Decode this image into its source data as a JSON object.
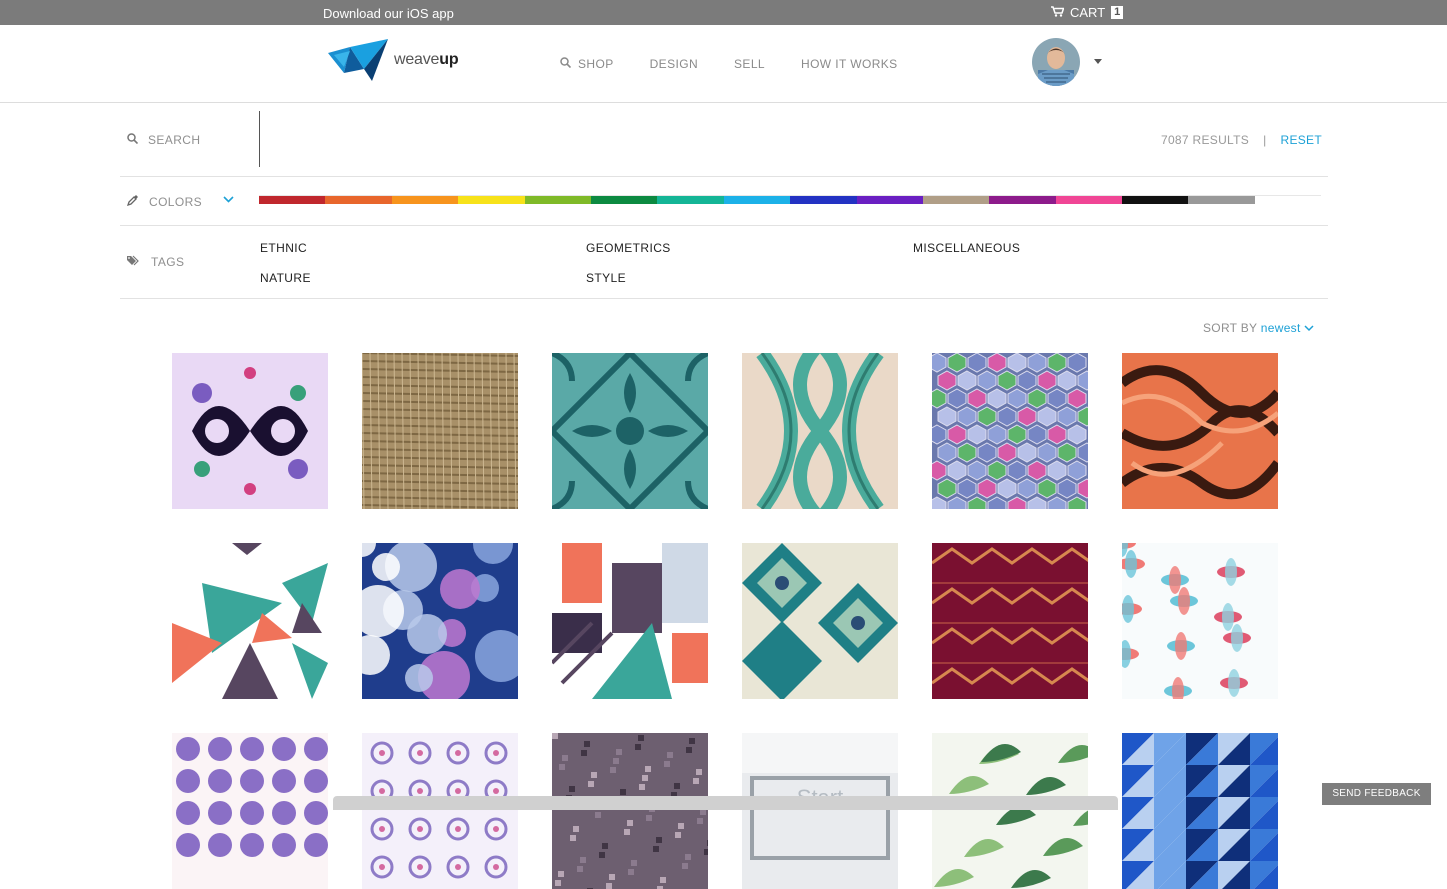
{
  "topbar": {
    "ios_label": "Download our iOS app",
    "cart_label": "CART",
    "cart_count": "1",
    "cart_icon": "cart-icon"
  },
  "brand": {
    "name_light": "weave",
    "name_bold": "up"
  },
  "nav": [
    {
      "label": "SHOP",
      "icon": "search-icon"
    },
    {
      "label": "DESIGN"
    },
    {
      "label": "SELL"
    },
    {
      "label": "HOW IT WORKS"
    }
  ],
  "filters": {
    "search_label": "SEARCH",
    "results": "7087 RESULTS",
    "separator": "|",
    "reset": "RESET",
    "colors_label": "COLORS",
    "tags_label": "TAGS",
    "color_swatches": [
      "#c0272d",
      "#e8662c",
      "#f7941d",
      "#f7e21a",
      "#7fba28",
      "#0c8a41",
      "#14b596",
      "#1cb1e8",
      "#2332c3",
      "#6a1fc2",
      "#b09e87",
      "#8d1b8b",
      "#f04595",
      "#111111",
      "#999999",
      "#ffffff"
    ],
    "tags": [
      "ETHNIC",
      "GEOMETRICS",
      "MISCELLANEOUS",
      "NATURE",
      "STYLE"
    ]
  },
  "sort": {
    "label": "SORT BY",
    "value": "newest"
  },
  "feedback": "SEND FEEDBACK",
  "designs": [
    "kaleidoscope-lavender",
    "burlap-texture",
    "teal-damask-tile",
    "teal-lattice",
    "hexagon-pastel",
    "orange-marble",
    "triangles-teal-coral",
    "blue-floral-abstract",
    "geometric-collage",
    "teal-ikat",
    "burgundy-zigzag",
    "coral-blue-floral",
    "purple-dots",
    "lavender-kaleidoscope",
    "grey-mosaic",
    "start-sign-photo",
    "green-leaves",
    "blue-triangles"
  ]
}
